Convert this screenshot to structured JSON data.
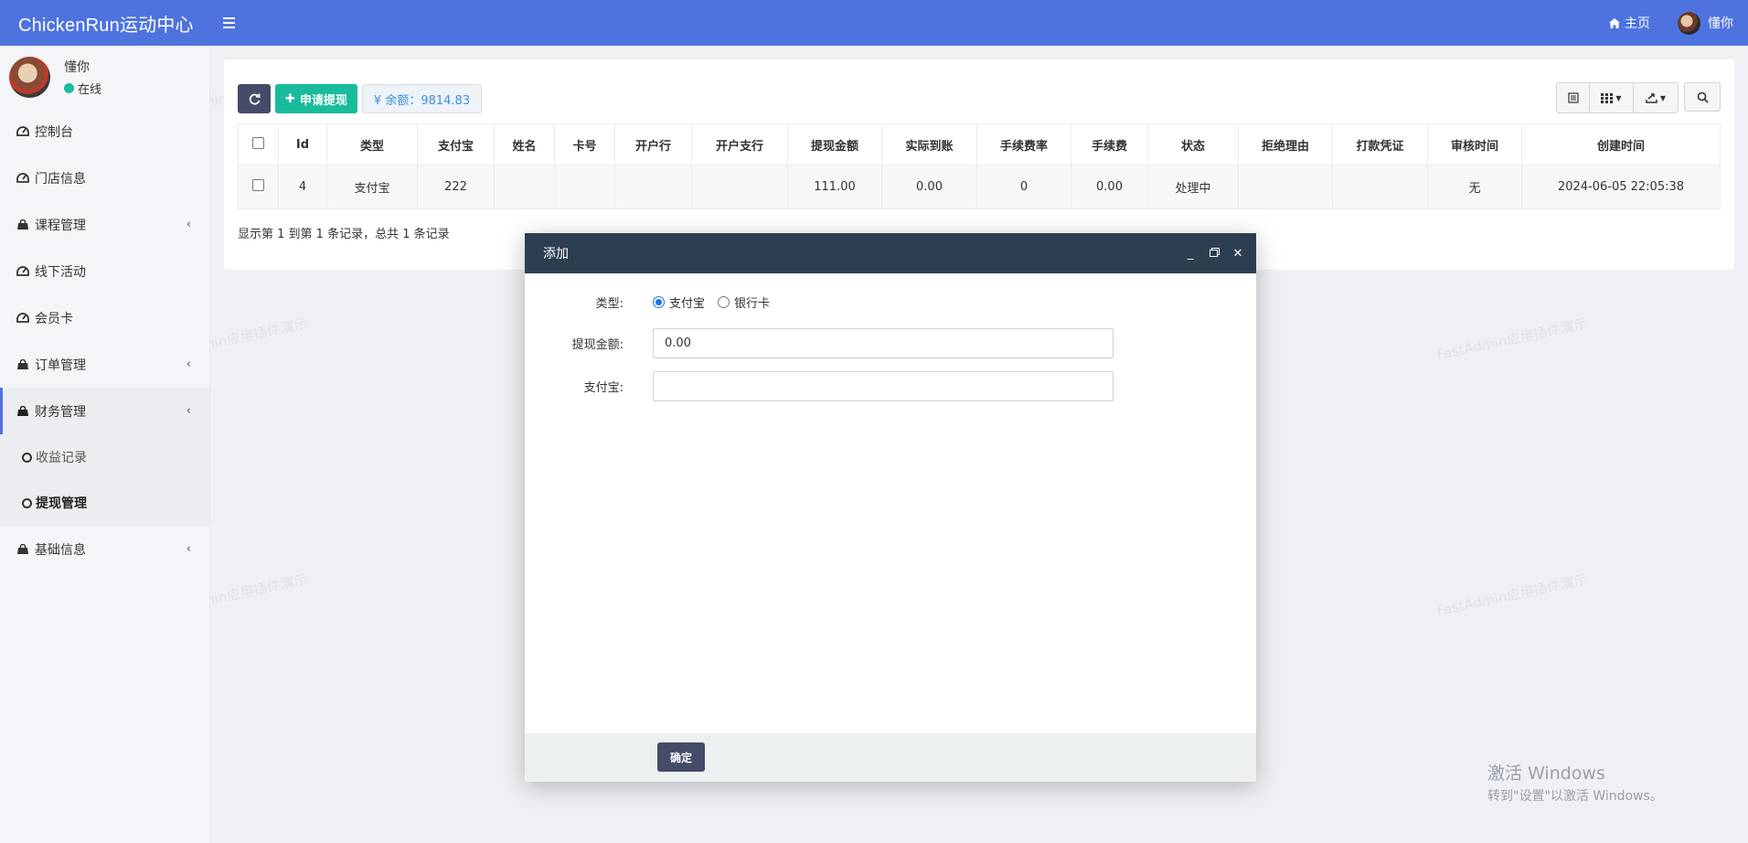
{
  "header": {
    "brand": "ChickenRun运动中心",
    "home_label": "主页",
    "user_name": "懂你"
  },
  "sidebar": {
    "user": {
      "name": "懂你",
      "status": "在线"
    },
    "items": [
      {
        "label": "控制台",
        "icon": "dashboard-icon",
        "has_children": false
      },
      {
        "label": "门店信息",
        "icon": "dashboard-icon",
        "has_children": false
      },
      {
        "label": "课程管理",
        "icon": "bag-icon",
        "has_children": true
      },
      {
        "label": "线下活动",
        "icon": "dashboard-icon",
        "has_children": false
      },
      {
        "label": "会员卡",
        "icon": "dashboard-icon",
        "has_children": false
      },
      {
        "label": "订单管理",
        "icon": "bag-icon",
        "has_children": true
      },
      {
        "label": "财务管理",
        "icon": "bag-icon",
        "has_children": true,
        "active": true
      },
      {
        "label": "基础信息",
        "icon": "bag-icon",
        "has_children": true
      }
    ],
    "finance_sub": [
      {
        "label": "收益记录"
      },
      {
        "label": "提现管理",
        "active": true
      }
    ]
  },
  "toolbar": {
    "apply_label": "申请提现",
    "balance_label": "¥ 余额：9814.83"
  },
  "table": {
    "columns": [
      "Id",
      "类型",
      "支付宝",
      "姓名",
      "卡号",
      "开户行",
      "开户支行",
      "提现金额",
      "实际到账",
      "手续费率",
      "手续费",
      "状态",
      "拒绝理由",
      "打款凭证",
      "审核时间",
      "创建时间"
    ],
    "rows": [
      {
        "id": "4",
        "type": "支付宝",
        "alipay": "222",
        "name": "",
        "card_no": "",
        "bank": "",
        "branch": "",
        "amount": "111.00",
        "actual": "0.00",
        "fee_rate": "0",
        "fee": "0.00",
        "status": "处理中",
        "reject_reason": "",
        "voucher": "",
        "review_time": "无",
        "created_at": "2024-06-05 22:05:38"
      }
    ],
    "pager_text": "显示第 1 到第 1 条记录，总共 1 条记录"
  },
  "modal": {
    "title": "添加",
    "type_label": "类型:",
    "type_options": [
      "支付宝",
      "银行卡"
    ],
    "type_selected": "支付宝",
    "amount_label": "提现金额:",
    "amount_value": "0.00",
    "alipay_label": "支付宝:",
    "alipay_value": "",
    "confirm_label": "确定"
  },
  "windows_watermark": {
    "title": "激活 Windows",
    "subtitle": "转到\"设置\"以激活 Windows。"
  },
  "colors": {
    "header_bg": "#4e73df",
    "accent_green": "#18bc9c",
    "modal_header_bg": "#2c3e50",
    "dark_button": "#444c69"
  }
}
